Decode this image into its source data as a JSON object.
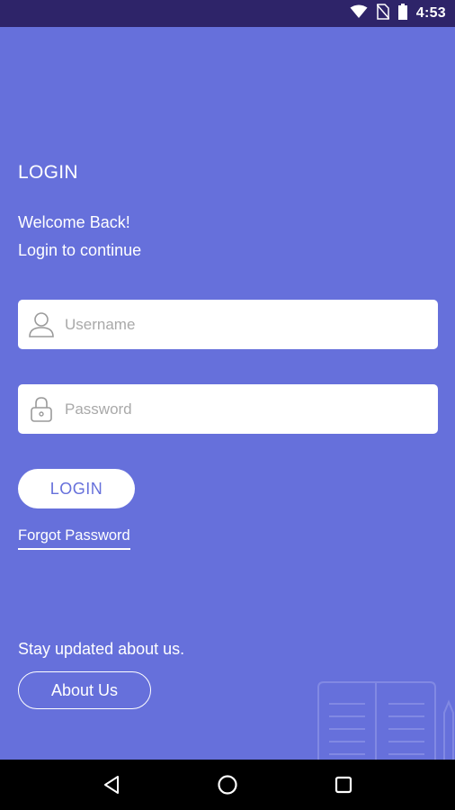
{
  "status_bar": {
    "time": "4:53",
    "icons": [
      "wifi-icon",
      "no-sim-icon",
      "battery-icon"
    ],
    "background": "#2E2469"
  },
  "login": {
    "title": "LOGIN",
    "welcome": "Welcome Back!",
    "subtitle": "Login to continue",
    "username_placeholder": "Username",
    "password_placeholder": "Password",
    "login_button": "LOGIN",
    "forgot_password": "Forgot Password"
  },
  "footer": {
    "stay_updated": "Stay updated about us.",
    "about_button": "About Us"
  },
  "nav_bar": {
    "icons": [
      "back-icon",
      "home-icon",
      "recents-icon"
    ]
  },
  "colors": {
    "background": "#6670DB",
    "field": "#FFFFFF",
    "accent_text": "#6670DB"
  }
}
